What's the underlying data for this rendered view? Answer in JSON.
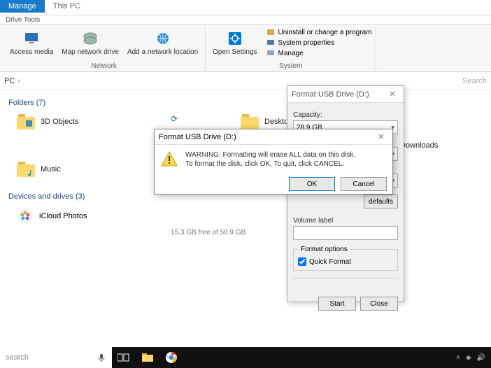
{
  "tabs": {
    "manage": "Manage",
    "thispc": "This PC",
    "drivetools": "Drive Tools"
  },
  "ribbon": {
    "access_media": "Access media",
    "map_network": "Map network drive",
    "add_network": "Add a network location",
    "open_settings": "Open Settings",
    "uninstall": "Uninstall or change a program",
    "sysprops": "System properties",
    "manage": "Manage",
    "group_network": "Network",
    "group_system": "System"
  },
  "addr": {
    "pc": "PC",
    "search": "Search"
  },
  "sections": {
    "folders_header": "Folders (7)",
    "drives_header": "Devices and drives (3)"
  },
  "folders": {
    "objects3d": "3D Objects",
    "desktop": "Desktop",
    "downloads": "Downloads",
    "music": "Music"
  },
  "drives": {
    "icloud": "iCloud Photos",
    "freespace": "15.3 GB free of 56.9 GB"
  },
  "format_dlg": {
    "title": "Format USB Drive (D:)",
    "capacity_label": "Capacity:",
    "capacity_value": "28.9 GB",
    "restore": "defaults",
    "volume_label": "Volume label",
    "volume_value": "",
    "format_options": "Format options",
    "quick_format": "Quick Format",
    "start": "Start",
    "close": "Close"
  },
  "warn_dlg": {
    "title": "Format USB Drive (D:)",
    "line1": "WARNING: Formatting will erase ALL data on this disk.",
    "line2": "To format the disk, click OK. To quit, click CANCEL.",
    "ok": "OK",
    "cancel": "Cancel"
  },
  "taskbar": {
    "search_placeholder": "search"
  }
}
